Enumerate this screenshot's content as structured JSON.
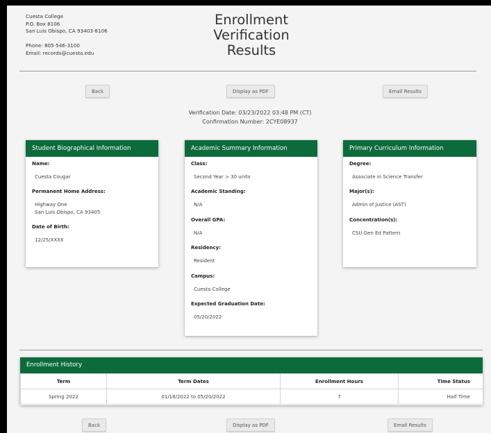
{
  "header": {
    "college": "Cuesta College",
    "po_box": "P.O. Box 8106",
    "city": "San Luis Obispo, CA 93403-8106",
    "phone": "Phone: 805-546-3100",
    "email": "Email: records@cuesta.edu",
    "title_line1": "Enrollment",
    "title_line2": "Verification",
    "title_line3": "Results"
  },
  "actions": {
    "back": "Back",
    "display_pdf": "Display as PDF",
    "email_results": "Email Results"
  },
  "verification": {
    "date": "Verification Date: 03/23/2022 03:48 PM (CT)",
    "confirmation": "Confirmation Number: 2CYE08937"
  },
  "biographical": {
    "title": "Student Biographical Information",
    "name_label": "Name:",
    "name": "Cuesta Cougar",
    "address_label": "Permanent Home Address:",
    "address_line1": "Highway One",
    "address_line2": "San Luis Obispo, CA 93405",
    "dob_label": "Date of Birth:",
    "dob": "12/25/XXXX"
  },
  "academic": {
    "title": "Academic Summary Information",
    "class_label": "Class:",
    "class": "Second Year > 30 units",
    "standing_label": "Academic Standing:",
    "standing": "N/A",
    "gpa_label": "Overall GPA:",
    "gpa": "N/A",
    "residency_label": "Residency:",
    "residency": "Resident",
    "campus_label": "Campus:",
    "campus": "Cuesta College",
    "grad_label": "Expected Graduation Date:",
    "grad": "05/20/2022"
  },
  "curriculum": {
    "title": "Primary Curriculum Information",
    "degree_label": "Degree:",
    "degree": "Associate in Science Transfer",
    "major_label": "Major(s):",
    "major": "Admin of Justice (AST)",
    "concentration_label": "Concentration(s):",
    "concentration": "CSU Gen Ed Pattern"
  },
  "history": {
    "title": "Enrollment History",
    "columns": [
      "Term",
      "Term Dates",
      "Enrollment Hours",
      "Time Status"
    ],
    "rows": [
      [
        "Spring 2022",
        "01/18/2022 to 05/20/2022",
        "7",
        "Half Time"
      ]
    ]
  },
  "colors": {
    "accent": "#0c6b3a"
  }
}
